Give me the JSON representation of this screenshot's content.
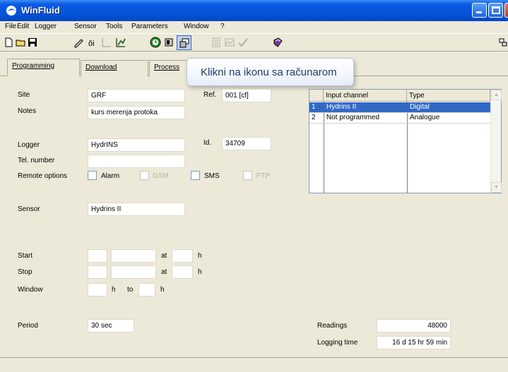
{
  "window": {
    "title": "WinFluid"
  },
  "menu": [
    "File",
    "Edit",
    "Logger",
    "Sensor",
    "Tools",
    "Parameters",
    "Window",
    "?"
  ],
  "tabs": [
    "Programming",
    "Download",
    "Process"
  ],
  "tooltip": "Klikni na ikonu sa računarom",
  "form": {
    "site_label": "Site",
    "site_value": "GRF",
    "ref_label": "Ref.",
    "ref_value": "001  [cf]",
    "notes_label": "Notes",
    "notes_value": "kurs merenja protoka",
    "logger_label": "Logger",
    "logger_value": "HydrINS",
    "id_label": "Id.",
    "id_value": "34709",
    "tel_label": "Tel. number",
    "tel_value": "",
    "remote_label": "Remote options",
    "options": {
      "alarm": "Alarm",
      "gsm": "GSM",
      "sms": "SMS",
      "ftp": "FTP"
    },
    "sensor_label": "Sensor",
    "sensor_value": "Hydrins II",
    "start_label": "Start",
    "stop_label": "Stop",
    "window_label": "Window",
    "at": "at",
    "h": "h",
    "to": "to",
    "period_label": "Period",
    "period_value": "30 sec",
    "readings_label": "Readings",
    "readings_value": "48000",
    "logging_label": "Logging time",
    "logging_value": "16 d 15 hr 59 min"
  },
  "channels": {
    "headers": [
      "",
      "Input channel",
      "Type"
    ],
    "rows": [
      {
        "num": "1",
        "name": "Hydrins II",
        "type": "Digital",
        "selected": true
      },
      {
        "num": "2",
        "name": "Not programmed",
        "type": "Analogue",
        "selected": false
      }
    ]
  },
  "colors": {
    "title_bar": "#0553d6",
    "selection": "#316ac5",
    "tooltip_text": "#1e3a68"
  }
}
